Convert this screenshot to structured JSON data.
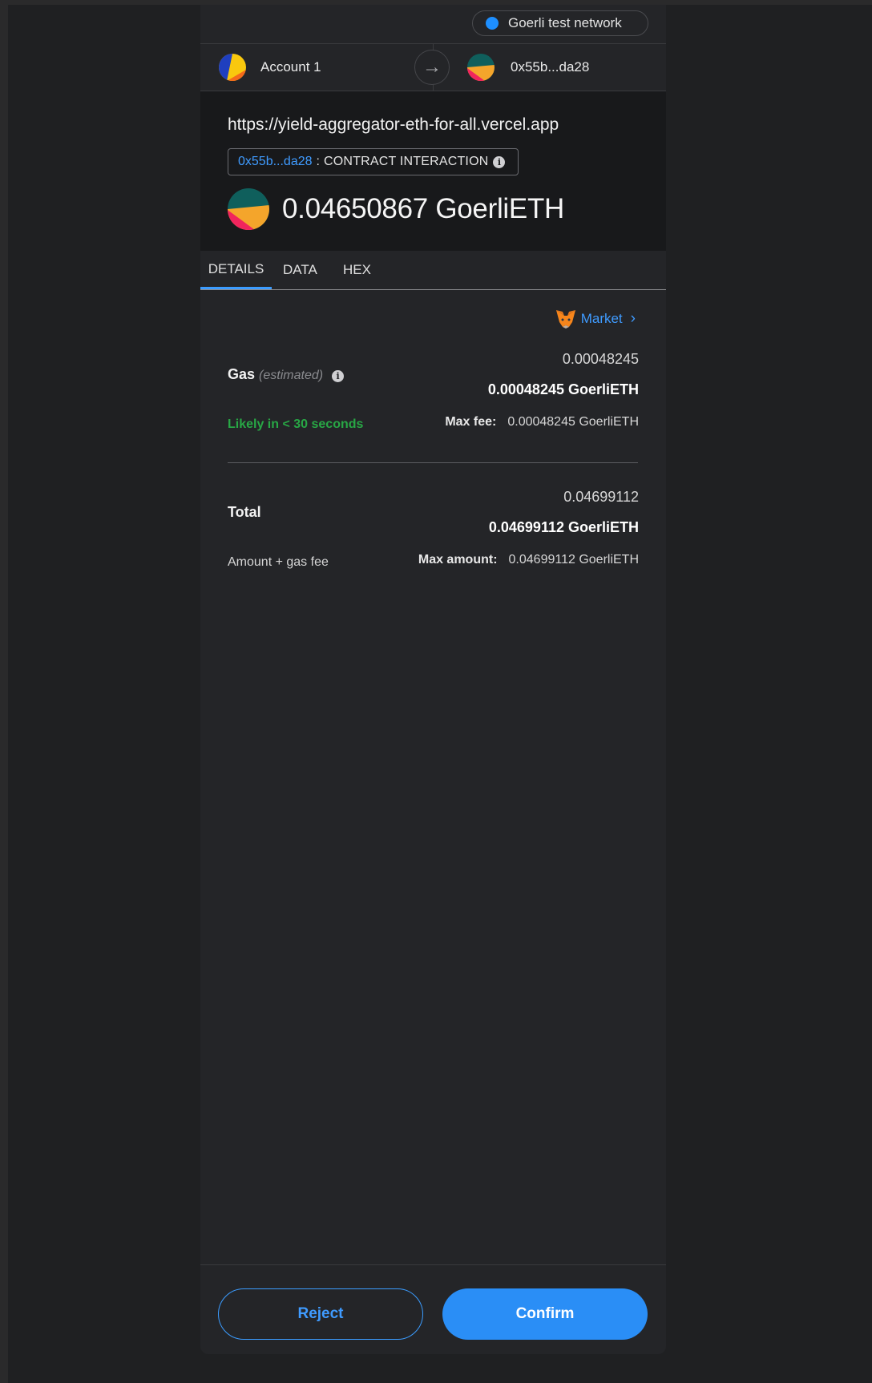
{
  "network": {
    "label": "Goerli test network",
    "dot_color": "#1e8fff"
  },
  "accounts": {
    "from_name": "Account 1",
    "to_address": "0x55b...da28",
    "arrow_icon": "arrow-right-icon"
  },
  "header": {
    "origin": "https://yield-aggregator-eth-for-all.vercel.app",
    "method_address": "0x55b...da28",
    "method_separator": ":",
    "method_name": "CONTRACT INTERACTION",
    "amount": "0.04650867 GoerliETH"
  },
  "tabs": [
    {
      "label": "DETAILS",
      "active": true
    },
    {
      "label": "DATA",
      "active": false
    },
    {
      "label": "HEX",
      "active": false
    }
  ],
  "details": {
    "market_label": "Market",
    "gas": {
      "label": "Gas",
      "qualifier": "(estimated)",
      "fiat_value": "0.00048245",
      "value": "0.00048245 GoerliETH",
      "timing": "Likely in < 30 seconds",
      "max_label": "Max fee:",
      "max_value": "0.00048245 GoerliETH"
    },
    "total": {
      "label": "Total",
      "fiat_value": "0.04699112",
      "value": "0.04699112 GoerliETH",
      "sub_label": "Amount + gas fee",
      "max_label": "Max amount:",
      "max_value": "0.04699112 GoerliETH"
    }
  },
  "footer": {
    "reject_label": "Reject",
    "confirm_label": "Confirm"
  },
  "colors": {
    "accent": "#3b9cff",
    "success": "#28a745",
    "background": "#242528"
  }
}
